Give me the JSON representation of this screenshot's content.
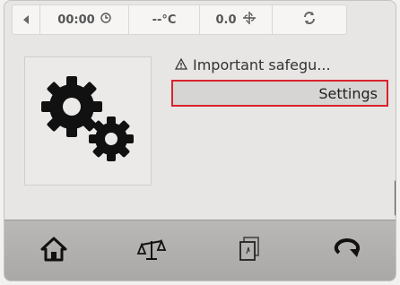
{
  "statusbar": {
    "time": "00:00",
    "temperature": "--°C",
    "fan_value": "0.0"
  },
  "menu": {
    "items": [
      {
        "label": "Important safegu...",
        "icon": "warning-icon"
      },
      {
        "label": "Settings",
        "selected": true
      }
    ]
  },
  "icons": {
    "back": "back-arrow-icon",
    "clock": "clock-icon",
    "fan": "fan-icon",
    "refresh": "refresh-icon",
    "gears": "gears-icon",
    "home": "home-icon",
    "scale": "scale-icon",
    "document": "document-icon",
    "return": "return-icon"
  },
  "colors": {
    "selection_border": "#d9232c",
    "selection_fill": "#d6d5d3",
    "nav_bar": "#b0afad"
  }
}
